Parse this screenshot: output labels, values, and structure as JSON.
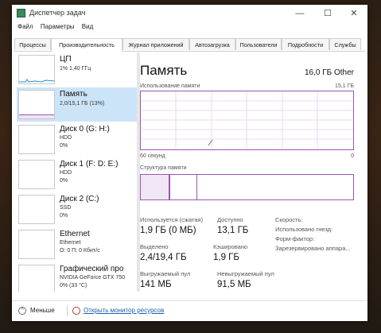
{
  "window": {
    "title": "Диспетчер задач"
  },
  "window_buttons": {
    "minimize": "—",
    "maximize": "☐",
    "close": "✕"
  },
  "menu": [
    "Файл",
    "Параметры",
    "Вид"
  ],
  "tabs": [
    "Процессы",
    "Производительность",
    "Журнал приложений",
    "Автозагрузка",
    "Пользователи",
    "Подробности",
    "Службы"
  ],
  "active_tab": 1,
  "sidebar": {
    "items": [
      {
        "title": "ЦП",
        "lines": [
          "1% 1,40 ГГц"
        ]
      },
      {
        "title": "Память",
        "lines": [
          "2,0/15,1 ГБ (13%)"
        ]
      },
      {
        "title": "Диск 0 (G: H:)",
        "lines": [
          "HDD",
          "0%"
        ]
      },
      {
        "title": "Диск 1 (F: D: E:)",
        "lines": [
          "HDD",
          "0%"
        ]
      },
      {
        "title": "Диск 2 (C:)",
        "lines": [
          "SSD",
          "0%"
        ]
      },
      {
        "title": "Ethernet",
        "lines": [
          "Ethernet",
          "О: 0 П: 0 Кбит/с"
        ]
      },
      {
        "title": "Графический про",
        "lines": [
          "NVIDIA GeForce GTX 750",
          "0% (33 °C)"
        ]
      }
    ],
    "selected": 1
  },
  "main": {
    "title": "Память",
    "total": "16,0 ГБ Other",
    "usage_label": "Использование памяти",
    "usage_max": "15,1 ГБ",
    "time_left": "60 секунд",
    "time_right": "0",
    "composition_label": "Структура памяти",
    "stats": [
      {
        "label": "Используется (сжатая)",
        "value": "1,9 ГБ (0 МБ)"
      },
      {
        "label": "Доступно",
        "value": "13,1 ГБ"
      },
      {
        "label": "Выделено",
        "value": "2,4/19,4 ГБ"
      },
      {
        "label": "Кэшировано",
        "value": "1,9 ГБ"
      },
      {
        "label": "Выгружаемый пул",
        "value": "141 МБ"
      },
      {
        "label": "Невыгружаемый пул",
        "value": "91,5 МБ"
      }
    ],
    "info_labels": [
      "Скорость:",
      "Использовано гнезд:",
      "Форм-фактор:",
      "Зарезервировано аппара..."
    ]
  },
  "footer": {
    "less": "Меньше",
    "resource_monitor": "Открыть монитор ресурсов"
  },
  "colors": {
    "accent": "#9b56b3",
    "cpu_line": "#1f8ad8",
    "selection": "#cce4f7",
    "disk_line": "#4aa02c",
    "link": "#1a5fb4"
  }
}
